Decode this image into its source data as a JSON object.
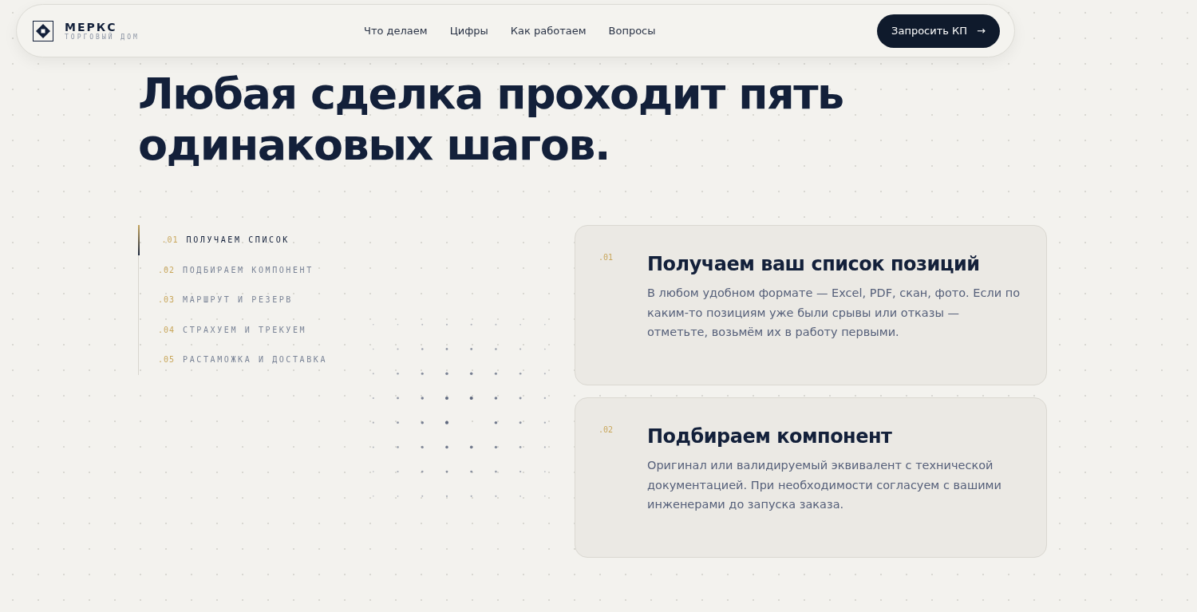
{
  "nav": {
    "brand": "МЕРКС",
    "tagline": "ТОРГОВЫЙ ДОМ",
    "links": [
      "Что делаем",
      "Цифры",
      "Как работаем",
      "Вопросы"
    ],
    "cta": "Запросить КП",
    "cta_arrow": "→"
  },
  "heading": "Любая сделка проходит пять одинаковых шагов.",
  "steps": [
    {
      "number": ".01",
      "label": "ПОЛУЧАЕМ СПИСОК",
      "selected": true
    },
    {
      "number": ".02",
      "label": "ПОДБИРАЕМ КОМПОНЕНТ",
      "selected": false
    },
    {
      "number": ".03",
      "label": "МАРШРУТ И РЕЗЕРВ",
      "selected": false
    },
    {
      "number": ".04",
      "label": "СТРАХУЕМ И ТРЕКУЕМ",
      "selected": false
    },
    {
      "number": ".05",
      "label": "РАСТАМОЖКА И ДОСТАВКА",
      "selected": false
    }
  ],
  "cards": [
    {
      "number": ".01",
      "title": "Получаем ваш список позиций",
      "text": "В любом удобном формате — Excel, PDF, скан, фото. Если по каким-то позициям уже были срывы или отказы — отметьте, возьмём их в работу первыми."
    },
    {
      "number": ".02",
      "title": "Подбираем компонент",
      "text": "Оригинал или валидируемый эквивалент с технической документацией. При необходимости согласуем с вашими инженерами до запуска заказа."
    }
  ]
}
